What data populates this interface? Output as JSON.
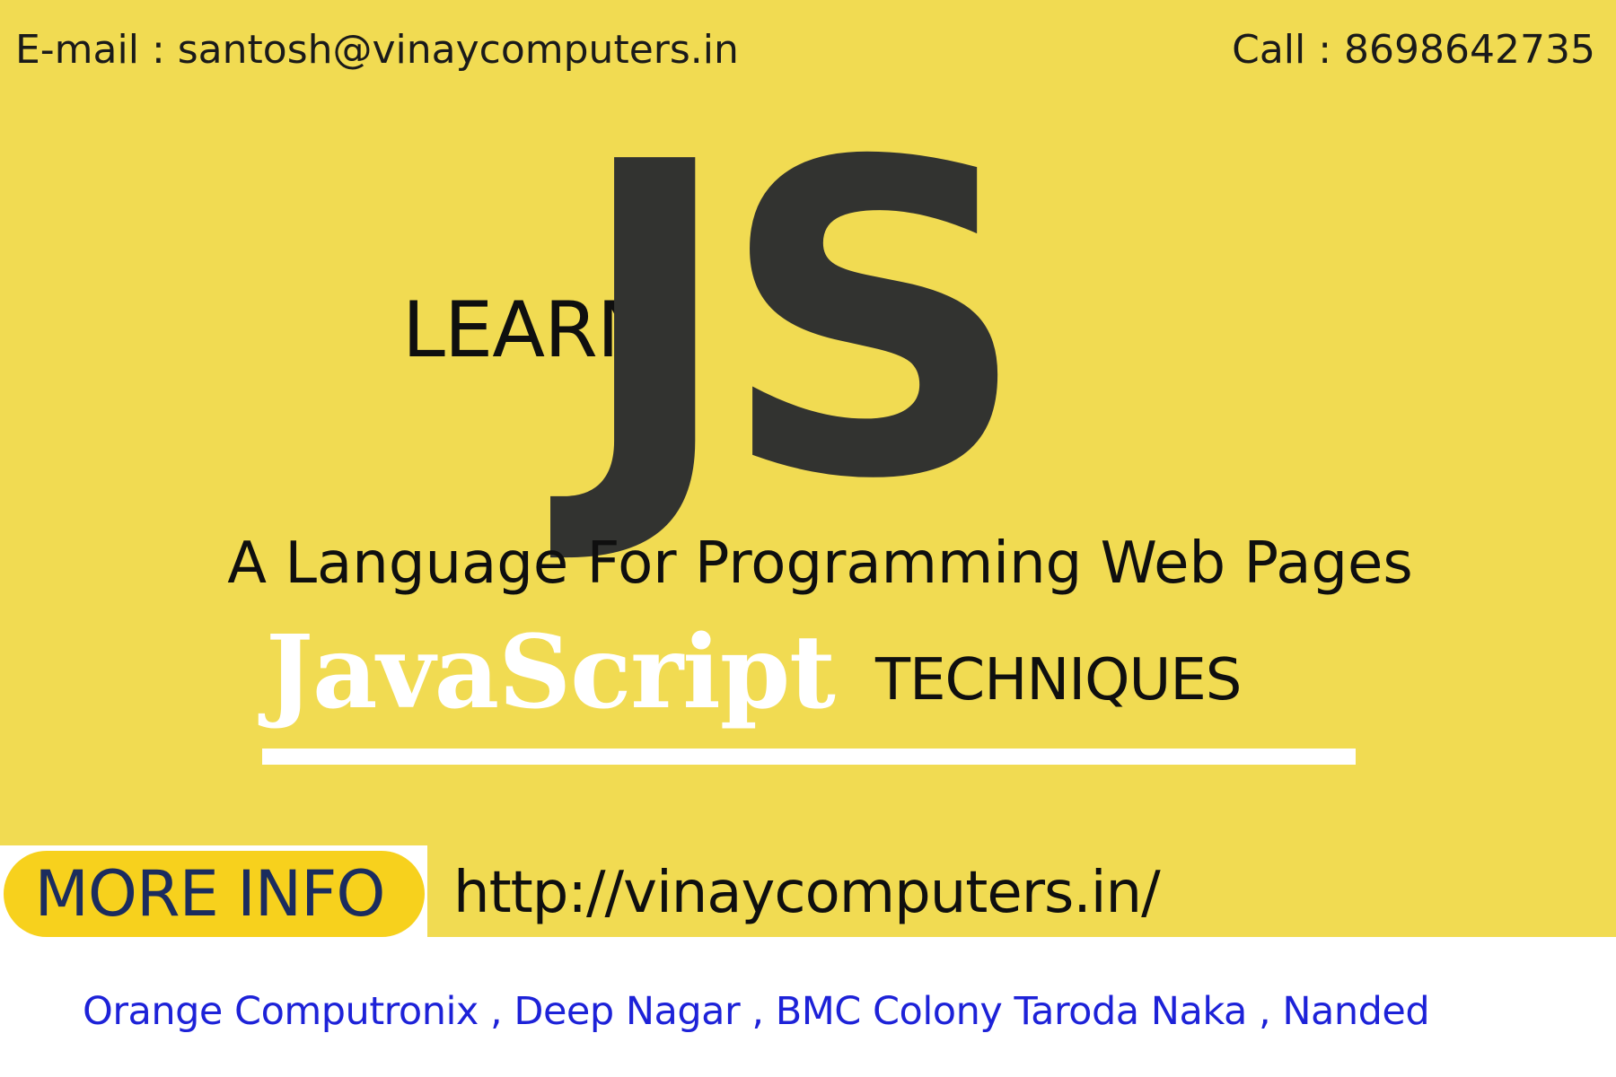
{
  "contact": {
    "email": "E-mail : santosh@vinaycomputers.in",
    "phone": "Call : 8698642735"
  },
  "hero": {
    "learn": "LEARN",
    "logo_text": "JS",
    "tagline": "A Language For Programming Web Pages",
    "script_word": "JavaScript",
    "techniques": "TECHNIQUES"
  },
  "cta": {
    "more_info_label": "MORE INFO",
    "url": "http://vinaycomputers.in/"
  },
  "footer": {
    "address": "Orange Computronix , Deep Nagar , BMC Colony  Taroda Naka , Nanded"
  },
  "colors": {
    "background": "#f1db52",
    "logo": "#323330",
    "button": "#f7d11d",
    "button_text": "#1b2c5e",
    "address_text": "#1d22d8"
  }
}
